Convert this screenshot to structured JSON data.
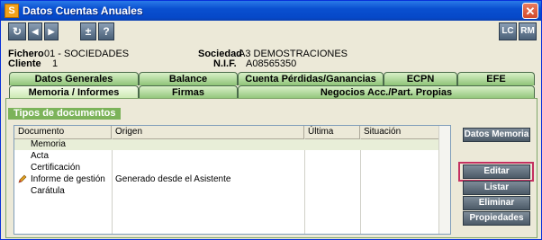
{
  "window": {
    "title": "Datos Cuentas Anuales",
    "app_icon": "S"
  },
  "toolbar": {
    "left_buttons": [
      {
        "name": "refresh-icon",
        "glyph": "↻"
      },
      {
        "name": "prev-icon",
        "glyph": "◀"
      },
      {
        "name": "next-icon",
        "glyph": "▶"
      },
      {
        "name": "plus-minus-icon",
        "glyph": "±"
      },
      {
        "name": "help-icon",
        "glyph": "?"
      }
    ],
    "lc_label": "LC",
    "rm_label": "RM"
  },
  "info": {
    "fichero_label": "Fichero",
    "fichero_value": "01 - SOCIEDADES",
    "cliente_label": "Cliente",
    "cliente_value": "1",
    "sociedad_label": "Sociedad",
    "sociedad_value": "A3 DEMOSTRACIONES",
    "nif_label": "N.I.F.",
    "nif_value": "A08565350"
  },
  "tabs_row1": [
    "Datos Generales",
    "Balance",
    "Cuenta Pérdidas/Ganancias",
    "ECPN",
    "EFE"
  ],
  "tabs_row2": [
    "Memoria / Informes",
    "Firmas",
    "Negocios Acc./Part. Propias"
  ],
  "active_tab": "Memoria / Informes",
  "group_label": "Tipos de documentos",
  "grid": {
    "columns": [
      "Documento",
      "Origen",
      "Última revisión",
      "Situación documento"
    ],
    "rows": [
      {
        "documento": "Memoria",
        "origen": "",
        "revision": "",
        "situacion": ""
      },
      {
        "documento": "Acta",
        "origen": "",
        "revision": "",
        "situacion": ""
      },
      {
        "documento": "Certificación",
        "origen": "",
        "revision": "",
        "situacion": ""
      },
      {
        "documento": "Informe de gestión",
        "origen": "Generado desde el Asistente",
        "revision": "",
        "situacion": "",
        "icon": "pencil-icon"
      },
      {
        "documento": "Carátula",
        "origen": "",
        "revision": "",
        "situacion": ""
      }
    ]
  },
  "side_buttons": {
    "datos_memoria": "Datos Memoria",
    "editar": "Editar",
    "listar": "Listar",
    "eliminar": "Eliminar",
    "propiedades": "Propiedades"
  }
}
